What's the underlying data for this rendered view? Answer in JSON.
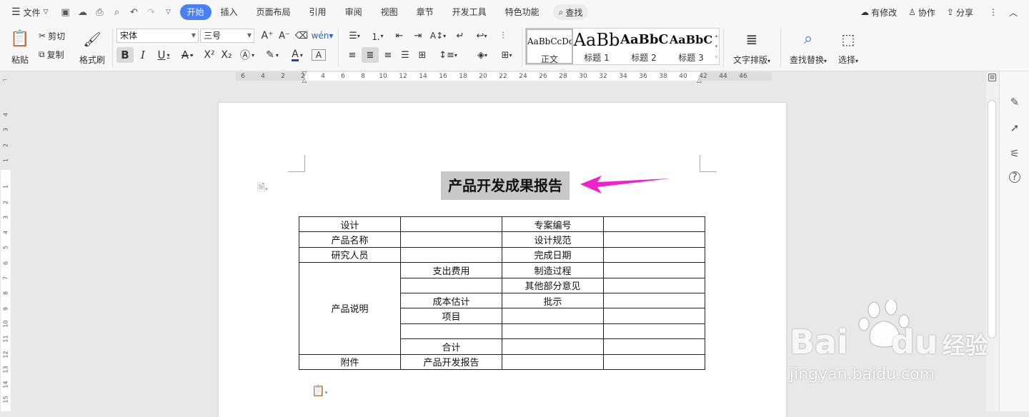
{
  "menubar": {
    "file_label": "文件",
    "tabs": [
      {
        "label": "开始",
        "active": true
      },
      {
        "label": "插入"
      },
      {
        "label": "页面布局"
      },
      {
        "label": "引用"
      },
      {
        "label": "审阅"
      },
      {
        "label": "视图"
      },
      {
        "label": "章节"
      },
      {
        "label": "开发工具"
      },
      {
        "label": "特色功能"
      }
    ],
    "search_label": "查找",
    "right": {
      "modified": "有修改",
      "collab": "协作",
      "share": "分享"
    }
  },
  "toolbar": {
    "paste": "粘贴",
    "cut": "剪切",
    "copy": "复制",
    "format_painter": "格式刷",
    "font_name": "宋体",
    "font_size": "三号",
    "styles": [
      {
        "preview": "AaBbCcDd",
        "name": "正文",
        "selected": true
      },
      {
        "preview": "AaBb",
        "name": "标题 1"
      },
      {
        "preview": "AaBbC",
        "name": "标题 2"
      },
      {
        "preview": "AaBbC",
        "name": "标题 3"
      }
    ],
    "text_layout": "文字排版",
    "find_replace": "查找替换",
    "select": "选择"
  },
  "ruler": {
    "top_numbers": [
      "6",
      "4",
      "2",
      "2",
      "4",
      "6",
      "8",
      "10",
      "12",
      "14",
      "16",
      "18",
      "20",
      "22",
      "24",
      "26",
      "28",
      "30",
      "32",
      "34",
      "36",
      "38",
      "40",
      "42",
      "44",
      "46"
    ],
    "left_numbers": [
      "4",
      "3",
      "2",
      "1",
      "1",
      "2",
      "3",
      "4",
      "5",
      "6",
      "7",
      "8",
      "9",
      "10",
      "11",
      "12",
      "13",
      "14",
      "15",
      "16"
    ]
  },
  "document": {
    "title": "产品开发成果报告",
    "table": [
      [
        "设计",
        "",
        "专案编号",
        ""
      ],
      [
        "产品名称",
        "",
        "设计规范",
        ""
      ],
      [
        "研究人员",
        "",
        "完成日期",
        ""
      ],
      [
        "产品说明",
        "支出费用",
        "制造过程",
        ""
      ],
      [
        "",
        "其他部分意见",
        ""
      ],
      [
        "成本估计",
        "批示",
        ""
      ],
      [
        "项目",
        "",
        ""
      ],
      [
        "",
        "",
        ""
      ],
      [
        "合计",
        "",
        ""
      ],
      [
        "附件",
        "产品开发报告",
        "",
        ""
      ]
    ]
  },
  "watermark": {
    "brand": "Bai",
    "brand2": "du",
    "cn": "经验",
    "url": "jingyan.baidu.com"
  },
  "colors": {
    "accent": "#4a7ff5",
    "arrow": "#ee22cc",
    "title_highlight": "#c8c8c8"
  }
}
